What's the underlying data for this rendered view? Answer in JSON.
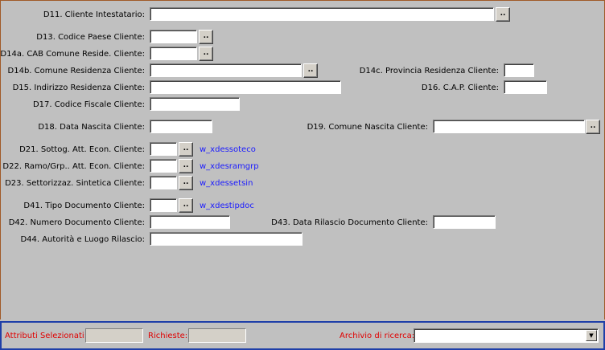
{
  "form": {
    "d11_label": "D11. Cliente Intestatario:",
    "d13_label": "D13. Codice Paese Cliente:",
    "d14a_label": "D14a. CAB Comune Reside. Cliente:",
    "d14b_label": "D14b. Comune Residenza Cliente:",
    "d14c_label": "D14c. Provincia Residenza Cliente:",
    "d15_label": "D15. Indirizzo Residenza Cliente:",
    "d16_label": "D16. C.A.P. Cliente:",
    "d17_label": "D17. Codice Fiscale Cliente:",
    "d18_label": "D18. Data Nascita Cliente:",
    "d19_label": "D19. Comune Nascita Cliente:",
    "d21_label": "D21. Sottog. Att. Econ. Cliente:",
    "d21_desc": "w_xdessoteco",
    "d22_label": "D22. Ramo/Grp.. Att. Econ. Cliente:",
    "d22_desc": "w_xdesramgrp",
    "d23_label": "D23. Settorizzaz. Sintetica Cliente:",
    "d23_desc": "w_xdessetsin",
    "d41_label": "D41. Tipo Documento Cliente:",
    "d41_desc": "w_xdestipdoc",
    "d42_label": "D42. Numero Documento Cliente:",
    "d43_label": "D43. Data Rilascio Documento Cliente:",
    "d44_label": "D44. Autorità e Luogo Rilascio:",
    "zoom_button_label": ".."
  },
  "statusbar": {
    "selected_attrs_label": "Attributi Selezionati:",
    "required_label": "Richieste:",
    "archive_label": "Archivio di ricerca:",
    "archive_value": ""
  },
  "colors": {
    "background": "#c0c0c0",
    "link": "#1a1aff",
    "status_label": "#e00000",
    "status_border": "#1f3fa8",
    "frame_border": "#a05a28"
  },
  "icons": {
    "zoom": "ellipsis-button",
    "dropdown": "triangle-down-icon"
  }
}
